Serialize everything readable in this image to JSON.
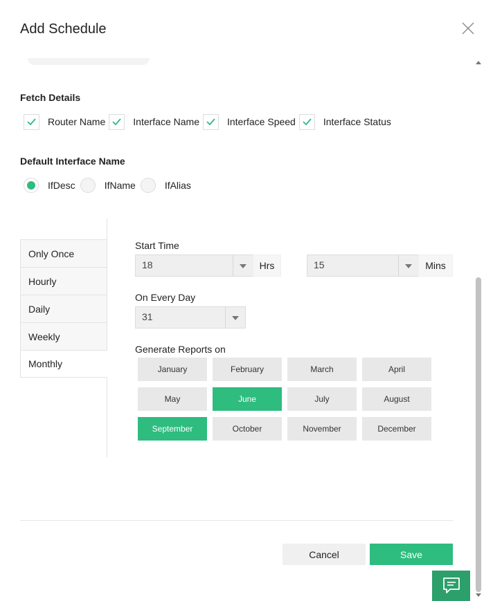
{
  "dialog": {
    "title": "Add Schedule"
  },
  "fetch_details": {
    "label": "Fetch Details",
    "options": [
      {
        "label": "Router Name",
        "checked": true
      },
      {
        "label": "Interface Name",
        "checked": true
      },
      {
        "label": "Interface Speed",
        "checked": true
      },
      {
        "label": "Interface Status",
        "checked": true
      }
    ]
  },
  "default_interface": {
    "label": "Default Interface Name",
    "options": [
      {
        "label": "IfDesc",
        "selected": true
      },
      {
        "label": "IfName",
        "selected": false
      },
      {
        "label": "IfAlias",
        "selected": false
      }
    ]
  },
  "frequency_tabs": [
    {
      "label": "Only Once",
      "active": false
    },
    {
      "label": "Hourly",
      "active": false
    },
    {
      "label": "Daily",
      "active": false
    },
    {
      "label": "Weekly",
      "active": false
    },
    {
      "label": "Monthly",
      "active": true
    }
  ],
  "start_time": {
    "label": "Start Time",
    "hours_value": "18",
    "hours_unit": "Hrs",
    "mins_value": "15",
    "mins_unit": "Mins"
  },
  "every_day": {
    "label": "On Every Day",
    "value": "31"
  },
  "generate_reports": {
    "label": "Generate Reports on",
    "months": [
      {
        "label": "January",
        "selected": false
      },
      {
        "label": "February",
        "selected": false
      },
      {
        "label": "March",
        "selected": false
      },
      {
        "label": "April",
        "selected": false
      },
      {
        "label": "May",
        "selected": false
      },
      {
        "label": "June",
        "selected": true
      },
      {
        "label": "July",
        "selected": false
      },
      {
        "label": "August",
        "selected": false
      },
      {
        "label": "September",
        "selected": true
      },
      {
        "label": "October",
        "selected": false
      },
      {
        "label": "November",
        "selected": false
      },
      {
        "label": "December",
        "selected": false
      }
    ]
  },
  "buttons": {
    "cancel": "Cancel",
    "save": "Save"
  },
  "colors": {
    "accent": "#2ebc7f",
    "chat": "#2c9f6b"
  },
  "icons": {
    "close": "close-icon",
    "check": "check-icon",
    "chat": "chat-icon",
    "dropdown": "chevron-down-icon"
  }
}
